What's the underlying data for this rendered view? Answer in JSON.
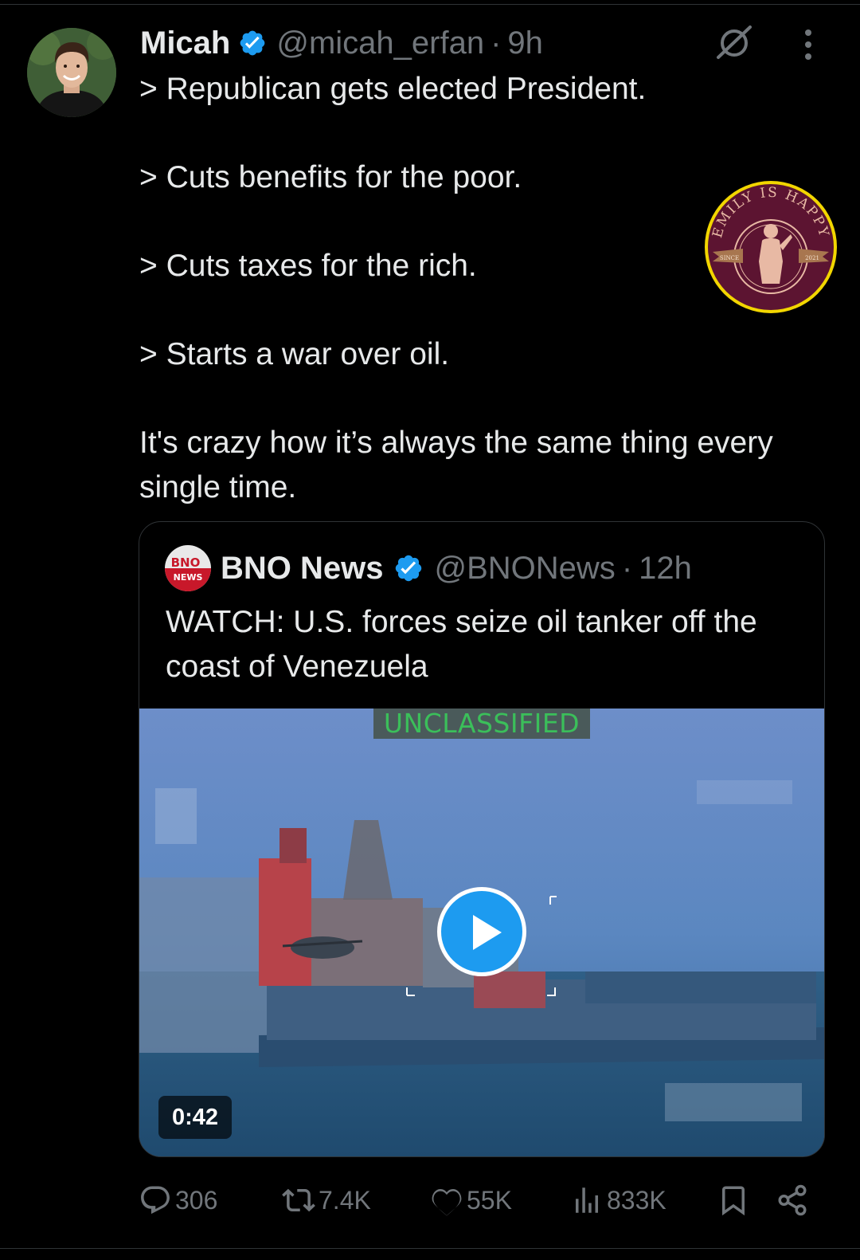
{
  "tweet": {
    "display_name": "Micah",
    "handle": "@micah_erfan",
    "separator": "·",
    "time": "9h",
    "lines": [
      "> Republican gets elected President.",
      "> Cuts benefits for the poor.",
      "> Cuts taxes for the rich.",
      "> Starts a war over oil.",
      "It's crazy how it’s always the same thing every single time."
    ],
    "icons": {
      "avatar": "avatar",
      "verified": "verified-badge-icon",
      "grok": "grok-icon",
      "more": "more-options-icon"
    }
  },
  "watermark": {
    "text": "EMILY IS HAPPY",
    "since": "SINCE",
    "year": "2021",
    "colors": {
      "ring": "#f2d600",
      "fill": "#5c1431",
      "figure": "#e8b9a4"
    }
  },
  "quote": {
    "display_name": "BNO News",
    "handle": "@BNONews",
    "separator": "·",
    "time": "12h",
    "logo_text_top": "BNO",
    "logo_text_bottom": "NEWS",
    "text": "WATCH: U.S. forces seize oil tanker off the coast of Venezuela",
    "media": {
      "overlay_label": "UNCLASSIFIED",
      "duration": "0:42",
      "play_icon": "play-icon"
    }
  },
  "actions": {
    "reply_count": "306",
    "repost_count": "7.4K",
    "like_count": "55K",
    "view_count": "833K"
  },
  "colors": {
    "background": "#000000",
    "text": "#e7e9ea",
    "muted": "#71767b",
    "accent": "#1d9bf0",
    "border": "#2f3336"
  }
}
